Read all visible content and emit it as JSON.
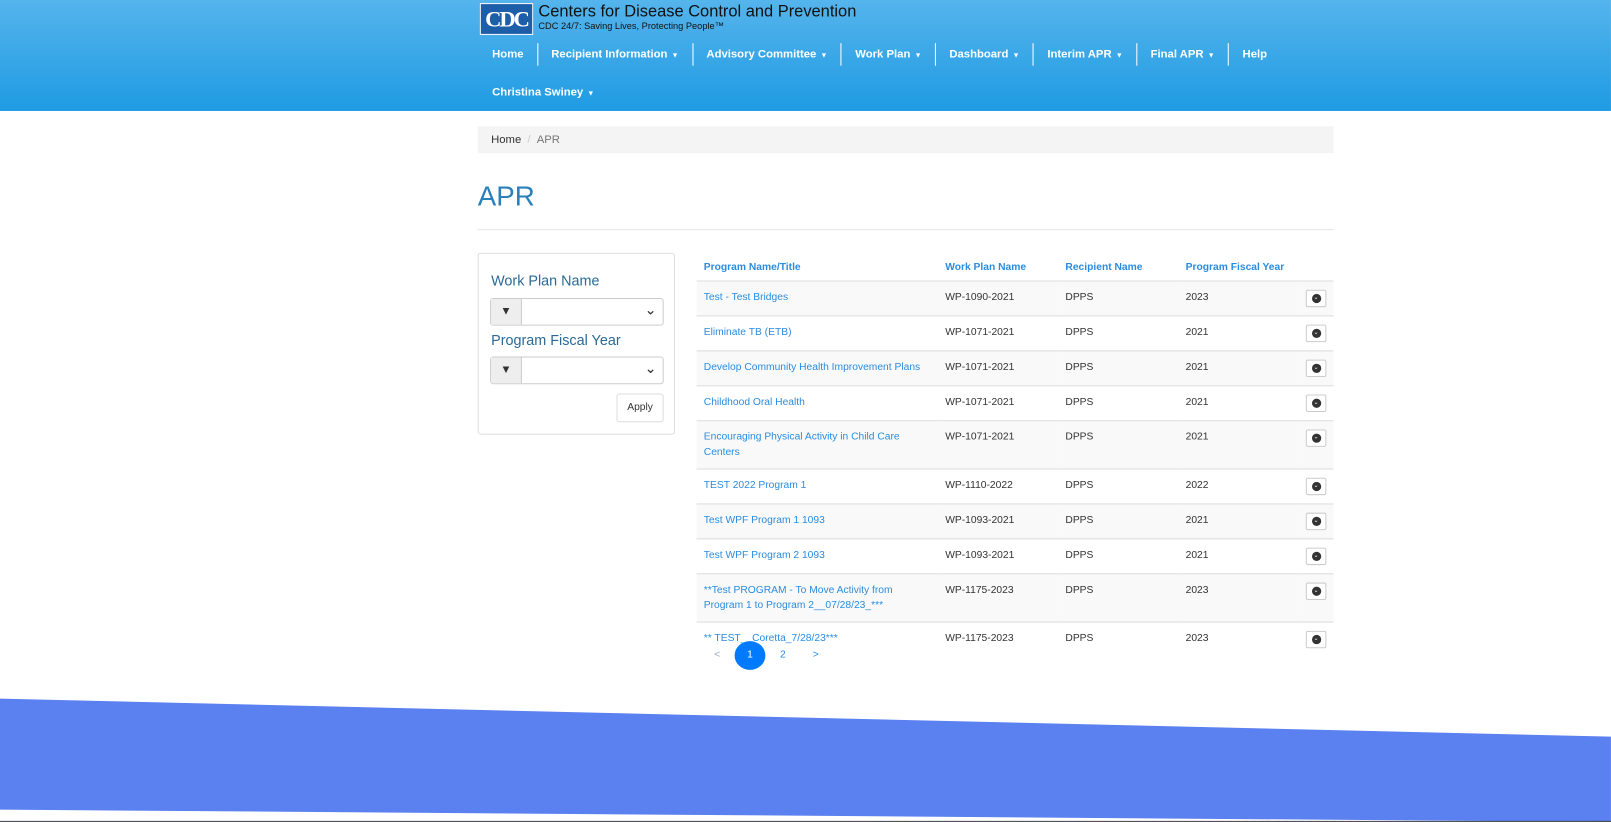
{
  "header": {
    "logo": "CDC",
    "title": "Centers for Disease Control and Prevention",
    "tagline": "CDC 24/7: Saving Lives, Protecting People™"
  },
  "nav": [
    {
      "label": "Home"
    },
    {
      "label": "Recipient Information",
      "dropdown": true
    },
    {
      "label": "Advisory Committee",
      "dropdown": true
    },
    {
      "label": "Work Plan",
      "dropdown": true
    },
    {
      "label": "Dashboard",
      "dropdown": true
    },
    {
      "label": "Interim APR",
      "dropdown": true
    },
    {
      "label": "Final APR",
      "dropdown": true
    },
    {
      "label": "Help"
    },
    {
      "label": "Christina Swiney",
      "dropdown": true
    }
  ],
  "breadcrumb": {
    "home": "Home",
    "separator": "/",
    "current": "APR"
  },
  "page_title": "APR",
  "filters": {
    "work_plan_label": "Work Plan Name",
    "work_plan_value": "",
    "fiscal_year_label": "Program Fiscal Year",
    "fiscal_year_value": "",
    "apply": "Apply"
  },
  "table": {
    "headers": [
      "Program Name/Title",
      "Work Plan Name",
      "Recipient Name",
      "Program Fiscal Year"
    ],
    "rows": [
      [
        "Test - Test Bridges",
        "WP-1090-2021",
        "DPPS",
        "2023"
      ],
      [
        "Eliminate TB (ETB)",
        "WP-1071-2021",
        "DPPS",
        "2021"
      ],
      [
        "Develop Community Health Improvement Plans",
        "WP-1071-2021",
        "DPPS",
        "2021"
      ],
      [
        "Childhood Oral Health",
        "WP-1071-2021",
        "DPPS",
        "2021"
      ],
      [
        "Encouraging Physical Activity in Child Care Centers",
        "WP-1071-2021",
        "DPPS",
        "2021"
      ],
      [
        "TEST 2022 Program 1",
        "WP-1110-2022",
        "DPPS",
        "2022"
      ],
      [
        "Test WPF Program 1 1093",
        "WP-1093-2021",
        "DPPS",
        "2021"
      ],
      [
        "Test WPF Program 2 1093",
        "WP-1093-2021",
        "DPPS",
        "2021"
      ],
      [
        "**Test PROGRAM - To Move Activity from Program 1 to Program 2__07/28/23_***",
        "WP-1175-2023",
        "DPPS",
        "2023"
      ],
      [
        "** TEST__Coretta_7/28/23***",
        "WP-1175-2023",
        "DPPS",
        "2023"
      ]
    ]
  },
  "pagination": {
    "prev": "<",
    "pages": [
      "1",
      "2"
    ],
    "current": "1",
    "next": ">"
  },
  "colors": {
    "header_top": "#55b4ec",
    "header_bottom": "#1f9be3",
    "link": "#2a8ce0",
    "footer": "#5b80f0",
    "active_page": "#007bff"
  }
}
